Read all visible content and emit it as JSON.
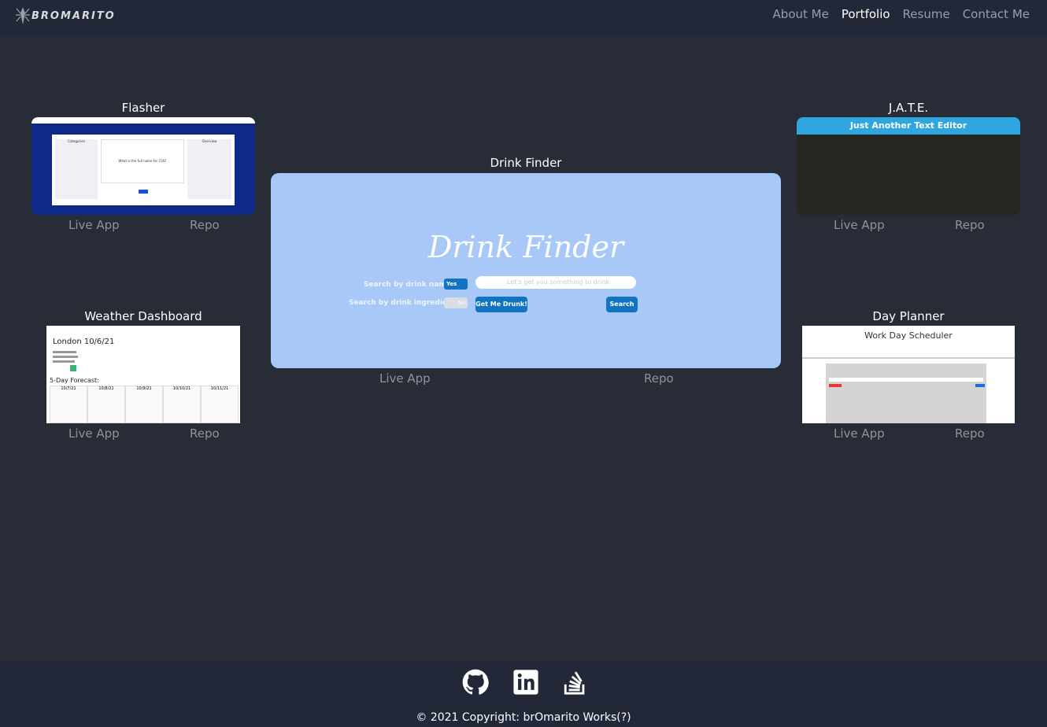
{
  "brand": {
    "name": "BROMARITO"
  },
  "nav": {
    "items": [
      {
        "label": "About Me",
        "active": false
      },
      {
        "label": "Portfolio",
        "active": true
      },
      {
        "label": "Resume",
        "active": false
      },
      {
        "label": "Contact Me",
        "active": false
      }
    ]
  },
  "projects": {
    "flasher": {
      "title": "Flasher",
      "live": "Live App",
      "repo": "Repo",
      "thumb": {
        "left_title": "Categories",
        "right_title": "Overview",
        "question": "What is the full name for CSS?"
      }
    },
    "jate": {
      "title": "J.A.T.E.",
      "live": "Live App",
      "repo": "Repo",
      "thumb": {
        "header": "Just Another Text Editor"
      }
    },
    "drink": {
      "title": "Drink Finder",
      "live": "Live App",
      "repo": "Repo",
      "thumb": {
        "logo": "Drink Finder",
        "search_name_label": "Search by drink name?",
        "search_ingredient_label": "Search by drink ingredient?",
        "toggle_yes": "Yes",
        "toggle_no": "No",
        "input_placeholder": "Let's get you something to drink",
        "random_button": "Get Me Drunk!",
        "search_button": "Search"
      }
    },
    "weather": {
      "title": "Weather Dashboard",
      "live": "Live App",
      "repo": "Repo",
      "thumb": {
        "city": "London 10/6/21",
        "forecast_label": "5-Day Forecast:",
        "days": [
          "10/7/21",
          "10/8/21",
          "10/9/21",
          "10/10/21",
          "10/11/21"
        ]
      }
    },
    "planner": {
      "title": "Day Planner",
      "live": "Live App",
      "repo": "Repo",
      "thumb": {
        "title": "Work Day Scheduler"
      }
    }
  },
  "footer": {
    "social": [
      "github-icon",
      "linkedin-icon",
      "stackoverflow-icon"
    ],
    "copyright": "© 2021 Copyright: brOmarito Works(?)"
  }
}
